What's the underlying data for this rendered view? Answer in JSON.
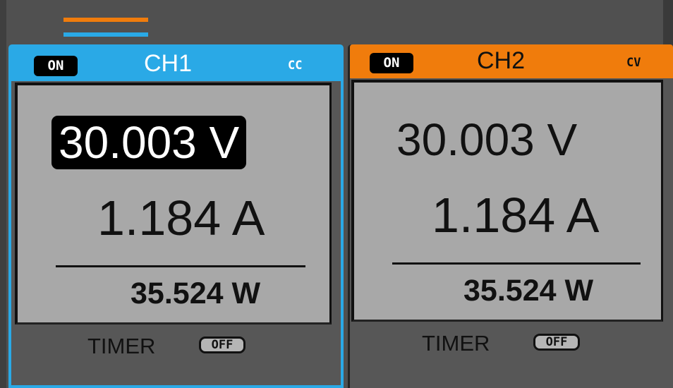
{
  "colors": {
    "ch1_accent": "#2aa9e6",
    "ch2_accent": "#f07c0c",
    "background": "#505050",
    "lcd": "#a8a8a8"
  },
  "channels": [
    {
      "status_badge": "ON",
      "name": "CH1",
      "mode": "CC",
      "voltage": "30.003 V",
      "current": "1.184 A",
      "power": "35.524  W",
      "timer_label": "TIMER",
      "timer_state": "OFF",
      "selected": true
    },
    {
      "status_badge": "ON",
      "name": "CH2",
      "mode": "CV",
      "voltage": "30.003 V",
      "current": "1.184 A",
      "power": "35.524  W",
      "timer_label": "TIMER",
      "timer_state": "OFF",
      "selected": false
    }
  ]
}
